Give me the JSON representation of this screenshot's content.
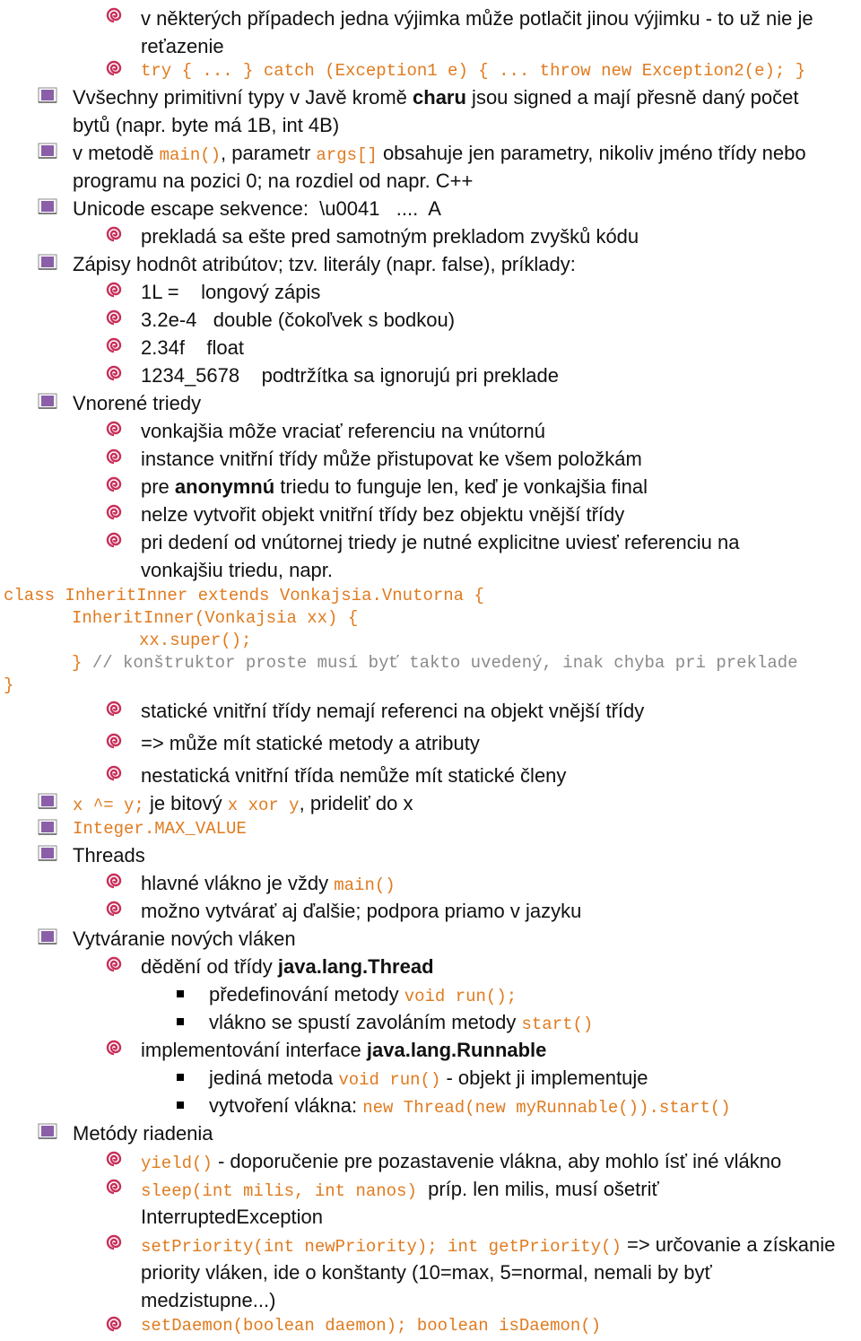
{
  "lines": {
    "a1": "v některých případech jedna výjimka může potlačit jinou výjimku - to už nie je",
    "a2": "reťazenie",
    "a3": "try { ... } catch (Exception1 e) { ... throw new Exception2(e); }",
    "b1a": "Vvšechny primitivní typy v Javě kromě ",
    "b1b": "charu",
    "b1c": " jsou signed a mají přesně daný počet",
    "b2": "bytů (napr. byte má 1B, int 4B)",
    "c1a": "v metodě ",
    "c1b": "main()",
    "c1c": ", parametr ",
    "c1d": "args[]",
    "c1e": " obsahuje jen parametry, nikoliv jméno třídy nebo",
    "c2": "programu na pozici 0; na rozdiel od napr. C++",
    "d1": "Unicode escape sekvence:  \\u0041   ....  A",
    "d2": "prekladá sa ešte pred samotným prekladom zvyšků kódu",
    "e1": "Zápisy hodnôt atribútov; tzv. literály (napr. false), príklady:",
    "e2": "1L =    longový zápis",
    "e3": "3.2e-4   double (čokoľvek s bodkou)",
    "e4": "2.34f    float",
    "e5": "1234_5678    podtržítka sa ignorujú pri preklade",
    "f1": "Vnorené triedy",
    "f2": "vonkajšia môže vraciať referenciu na vnútornú",
    "f3": "instance vnitřní třídy může přistupovat ke všem položkám",
    "f4a": "pre ",
    "f4b": "anonymnú",
    "f4c": " triedu to funguje len, keď je vonkajšia final",
    "f5": "nelze vytvořit objekt vnitřní třídy bez objektu vnější třídy",
    "f6": "pri dedení od vnútornej triedy je nutné explicitne uviesť referenciu na",
    "f7": "vonkajšiu triedu, napr.",
    "code1": "class InheritInner extends Vonkajsia.Vnutorna {",
    "code2": "InheritInner(Vonkajsia xx) {",
    "code3": "xx.super();",
    "code4a": "} ",
    "code4b": "// konštruktor proste musí byť takto uvedený, inak chyba pri preklade",
    "code5": "}",
    "g1": "statické vnitřní třídy nemají referenci na objekt vnější třídy",
    "g2": "=> může mít statické metody a atributy",
    "g3": "nestatická vnitřní třída nemůže mít statické členy",
    "h1a": "x ^= y;",
    "h1b": " je bitový ",
    "h1c": "x xor y",
    "h1d": ", prideliť do x",
    "i1": "Integer.MAX_VALUE",
    "j1": "Threads",
    "j2a": "hlavné vlákno je vždy ",
    "j2b": "main()",
    "j3": "možno vytvárať aj ďalšie; podpora priamo v jazyku",
    "k1": "Vytváranie nových vláken",
    "k2a": "dědění od třídy ",
    "k2b": "java.lang.Thread",
    "k3a": "předefinování metody ",
    "k3b": "void run();",
    "k4a": "vlákno se spustí zavoláním metody ",
    "k4b": "start()",
    "k5a": "implementování interface ",
    "k5b": "java.lang.Runnable",
    "k6a": "jediná metoda ",
    "k6b": "void run()",
    "k6c": " - objekt ji implementuje",
    "k7a": "vytvoření vlákna: ",
    "k7b": "new Thread(new myRunnable()).start()",
    "m1": "Metódy riadenia",
    "m2a": "yield()",
    "m2b": " - doporučenie pre pozastavenie vlákna, aby mohlo ísť iné vlákno",
    "m3a": "sleep(int milis, int nanos)",
    "m3b": "  príp. len milis, musí ošetriť",
    "m4": "InterruptedException",
    "m5a": "setPriority(int newPriority); int getPriority()",
    "m5b": " => určovanie a získanie",
    "m6": "priority vláken, ide o konštanty (10=max, 5=normal, nemali by byť",
    "m7": "medzistupne...)",
    "m8": "setDaemon(boolean daemon); boolean isDaemon()"
  },
  "colors": {
    "code": "#e07b1f",
    "comment": "#8a8a8a",
    "swirl": "#c8305a",
    "square": "#8b5fa8"
  }
}
